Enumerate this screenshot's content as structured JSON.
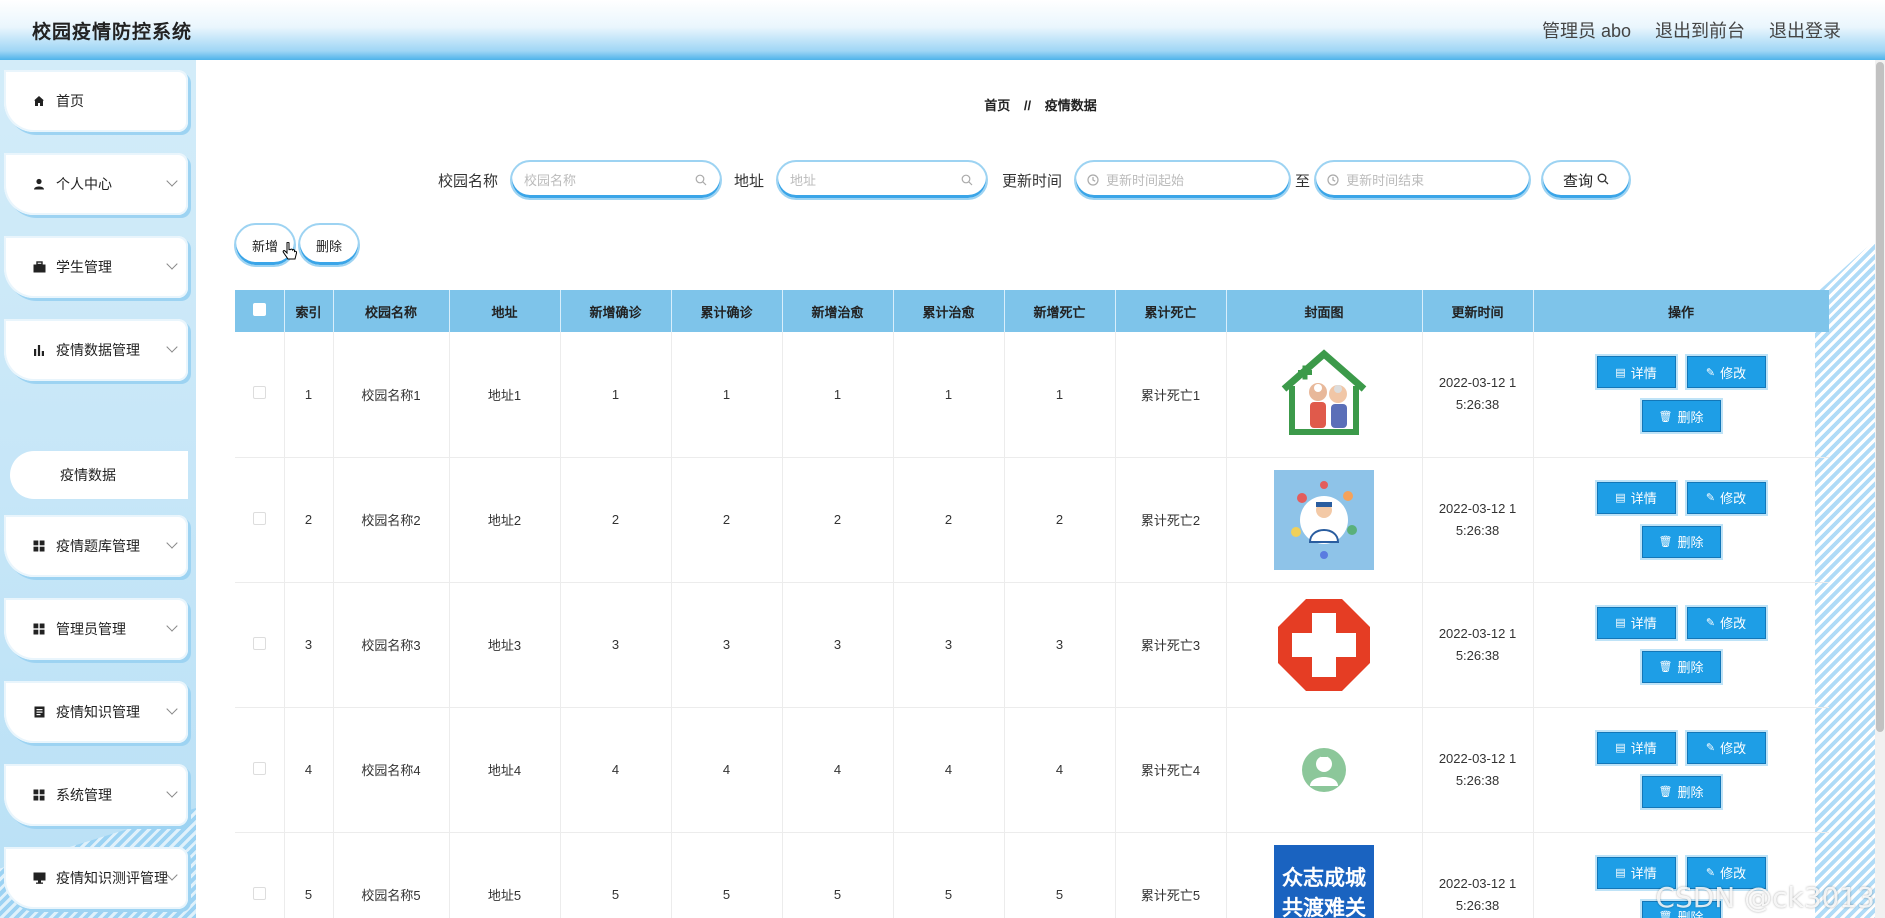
{
  "header": {
    "title": "校园疫情防控系统",
    "admin": "管理员 abo",
    "to_front": "退出到前台",
    "logout": "退出登录"
  },
  "sidebar": {
    "items": [
      {
        "label": "首页",
        "icon": "home-icon"
      },
      {
        "label": "个人中心",
        "icon": "user-icon"
      },
      {
        "label": "学生管理",
        "icon": "briefcase-icon"
      },
      {
        "label": "疫情数据管理",
        "icon": "bar-chart-icon"
      },
      {
        "label": "疫情题库管理",
        "icon": "grid-icon"
      },
      {
        "label": "管理员管理",
        "icon": "grid-icon"
      },
      {
        "label": "疫情知识管理",
        "icon": "document-icon"
      },
      {
        "label": "系统管理",
        "icon": "grid-icon"
      },
      {
        "label": "疫情知识测评管理",
        "icon": "monitor-icon"
      }
    ],
    "active_sub": "疫情数据"
  },
  "breadcrumb": {
    "home": "首页",
    "sep": "//",
    "current": "疫情数据"
  },
  "search": {
    "campus_label": "校园名称",
    "campus_placeholder": "校园名称",
    "address_label": "地址",
    "address_placeholder": "地址",
    "time_label": "更新时间",
    "time_start_placeholder": "更新时间起始",
    "to_label": "至",
    "time_end_placeholder": "更新时间结束",
    "query_button": "查询"
  },
  "actions": {
    "add": "新增",
    "delete": "删除"
  },
  "table": {
    "headers": [
      "索引",
      "校园名称",
      "地址",
      "新增确诊",
      "累计确诊",
      "新增治愈",
      "累计治愈",
      "新增死亡",
      "累计死亡",
      "封面图",
      "更新时间",
      "操作"
    ],
    "ops": {
      "detail": "详情",
      "edit": "修改",
      "delete": "删除"
    },
    "rows": [
      {
        "idx": "1",
        "name": "校园名称1",
        "addr": "地址1",
        "new_conf": "1",
        "total_conf": "1",
        "new_cure": "1",
        "total_cure": "1",
        "new_death": "1",
        "total_death": "累计死亡1",
        "time_a": "2022-03-12 1",
        "time_b": "5:26:38",
        "cover": "family-house-icon"
      },
      {
        "idx": "2",
        "name": "校园名称2",
        "addr": "地址2",
        "new_conf": "2",
        "total_conf": "2",
        "new_cure": "2",
        "total_cure": "2",
        "new_death": "2",
        "total_death": "累计死亡2",
        "time_a": "2022-03-12 1",
        "time_b": "5:26:38",
        "cover": "doctor-icon"
      },
      {
        "idx": "3",
        "name": "校园名称3",
        "addr": "地址3",
        "new_conf": "3",
        "total_conf": "3",
        "new_cure": "3",
        "total_cure": "3",
        "new_death": "3",
        "total_death": "累计死亡3",
        "time_a": "2022-03-12 1",
        "time_b": "5:26:38",
        "cover": "red-cross-icon"
      },
      {
        "idx": "4",
        "name": "校园名称4",
        "addr": "地址4",
        "new_conf": "4",
        "total_conf": "4",
        "new_cure": "4",
        "total_cure": "4",
        "new_death": "4",
        "total_death": "累计死亡4",
        "time_a": "2022-03-12 1",
        "time_b": "5:26:38",
        "cover": "nurse-badge-icon"
      },
      {
        "idx": "5",
        "name": "校园名称5",
        "addr": "地址5",
        "new_conf": "5",
        "total_conf": "5",
        "new_cure": "5",
        "total_cure": "5",
        "new_death": "5",
        "total_death": "累计死亡5",
        "time_a": "2022-03-12 1",
        "time_b": "5:26:38",
        "cover": "slogan-poster-icon",
        "poster_line1": "众志成城",
        "poster_line2": "共渡难关"
      }
    ]
  },
  "watermark": "CSDN @ck3013"
}
